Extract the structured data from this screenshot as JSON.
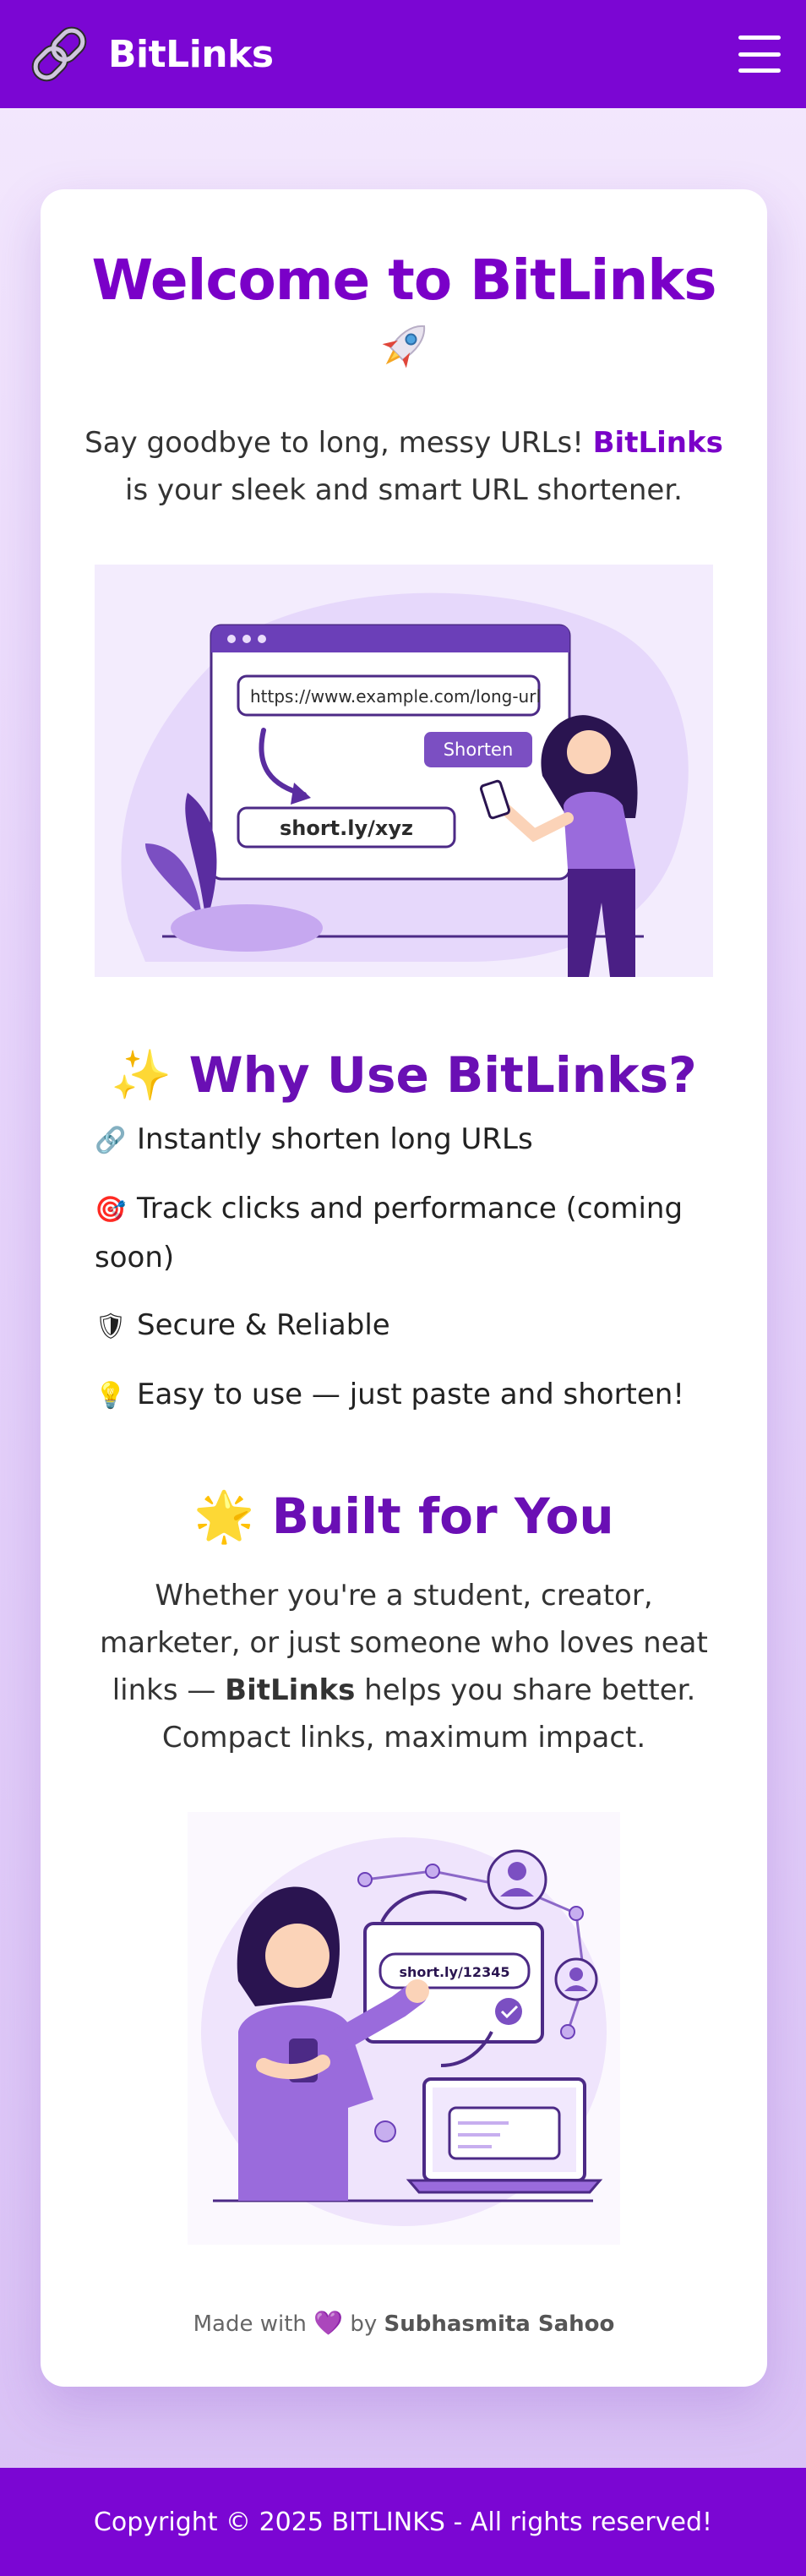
{
  "navbar": {
    "brand_name": "BitLinks",
    "logo_icon": "chain-link-icon",
    "menu_icon": "hamburger-menu-icon"
  },
  "hero": {
    "title": "Welcome to BitLinks",
    "title_emoji": "rocket-icon",
    "intro_before": "Say goodbye to long, messy URLs! ",
    "intro_highlight": "BitLinks",
    "intro_after": " is your sleek and smart URL shortener."
  },
  "hero_illustration": {
    "long_url": "https://www.example.com/long-url",
    "button_label": "Shorten",
    "short_url": "short.ly/xyz"
  },
  "why": {
    "emoji": "✨",
    "heading": "Why Use BitLinks?",
    "features": [
      {
        "icon": "🔗",
        "text": "Instantly shorten long URLs"
      },
      {
        "icon": "🎯",
        "text": "Track clicks and performance (coming soon)"
      },
      {
        "icon": "🛡",
        "text": "Secure & Reliable"
      },
      {
        "icon": "💡",
        "text": "Easy to use — just paste and shorten!"
      }
    ]
  },
  "built": {
    "emoji": "🌟",
    "heading": "Built for You",
    "text_before": "Whether you're a student, creator, marketer, or just someone who loves neat links — ",
    "text_bold": "BitLinks",
    "text_after": " helps you share better. Compact links, maximum impact."
  },
  "second_illustration": {
    "short_url": "short.ly/12345"
  },
  "credit": {
    "prefix": "Made with",
    "heart": "💜",
    "by": "by",
    "author": "Subhasmita Sahoo"
  },
  "footer": {
    "copyright": "Copyright © 2025 BITLINKS - All rights reserved!"
  },
  "colors": {
    "primary": "#7b06d3",
    "heading": "#6a0fb4",
    "light_purple": "#e9dcfb"
  }
}
